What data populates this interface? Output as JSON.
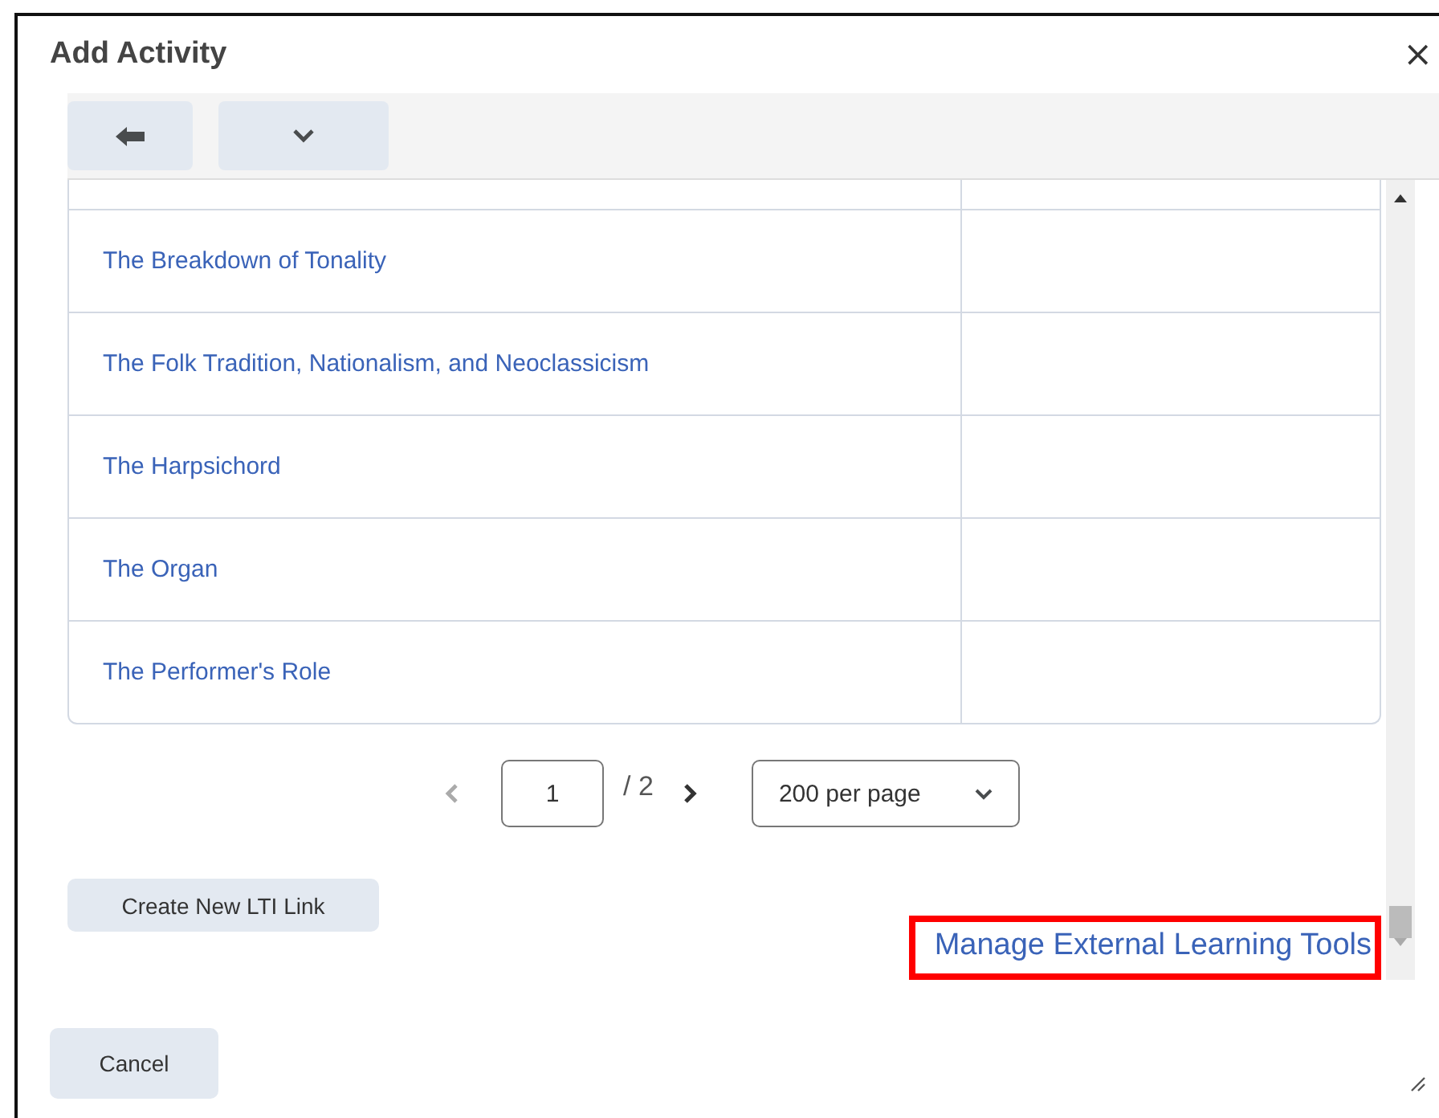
{
  "dialog": {
    "title": "Add Activity",
    "close": "×"
  },
  "table": {
    "rows": [
      {
        "name": "The Breakdown of Tonality"
      },
      {
        "name": "The Folk Tradition, Nationalism, and Neoclassicism"
      },
      {
        "name": "The Harpsichord"
      },
      {
        "name": "The Organ"
      },
      {
        "name": "The Performer's Role"
      }
    ]
  },
  "pagination": {
    "page": "1",
    "total": "/ 2",
    "per_page": "200 per page"
  },
  "create_button": "Create New LTI Link",
  "manage_link": {
    "label": "Manage External Learning Tools",
    "highlighted": true
  },
  "cancel_button": "Cancel"
}
